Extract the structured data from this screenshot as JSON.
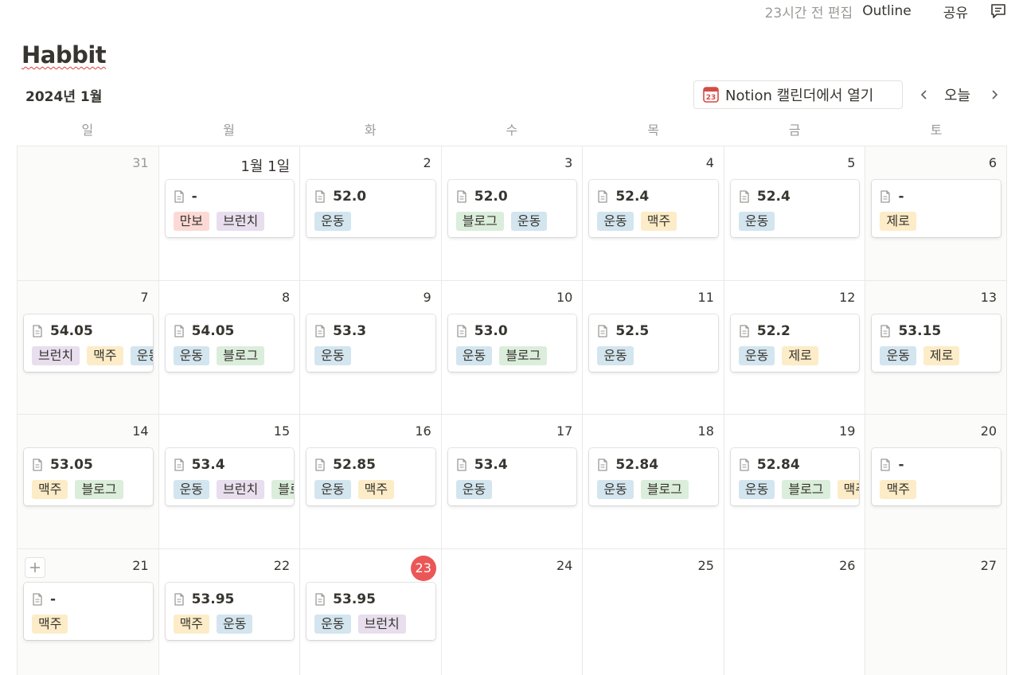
{
  "header": {
    "edited": "23시간 전 편집",
    "outline": "Outline",
    "share": "공유"
  },
  "page": {
    "title": "Habbit"
  },
  "calendar": {
    "month_label": "2024년 1월",
    "open_button_label": "Notion 캘린더에서 열기",
    "open_button_icon_number": "23",
    "today_label": "오늘",
    "weekdays": [
      "일",
      "월",
      "화",
      "수",
      "목",
      "금",
      "토"
    ],
    "tag_colors": {
      "만보": "#fdd9d6",
      "브런치": "#e8deee",
      "운동": "#d3e5ef",
      "블로그": "#dbeddb",
      "맥주": "#fdecc8",
      "제로": "#fdecc8"
    },
    "weeks": [
      [
        {
          "day": "31",
          "muted": true
        },
        {
          "day": "1월 1일",
          "first": true,
          "title": "-",
          "tags": [
            "만보",
            "브런치"
          ]
        },
        {
          "day": "2",
          "title": "52.0",
          "tags": [
            "운동"
          ]
        },
        {
          "day": "3",
          "title": "52.0",
          "tags": [
            "블로그",
            "운동"
          ]
        },
        {
          "day": "4",
          "title": "52.4",
          "tags": [
            "운동",
            "맥주"
          ]
        },
        {
          "day": "5",
          "title": "52.4",
          "tags": [
            "운동"
          ]
        },
        {
          "day": "6",
          "title": "-",
          "tags": [
            "제로"
          ]
        }
      ],
      [
        {
          "day": "7",
          "title": "54.05",
          "tags": [
            "브런치",
            "맥주",
            "운동"
          ]
        },
        {
          "day": "8",
          "title": "54.05",
          "tags": [
            "운동",
            "블로그"
          ]
        },
        {
          "day": "9",
          "title": "53.3",
          "tags": [
            "운동"
          ]
        },
        {
          "day": "10",
          "title": "53.0",
          "tags": [
            "운동",
            "블로그"
          ]
        },
        {
          "day": "11",
          "title": "52.5",
          "tags": [
            "운동"
          ]
        },
        {
          "day": "12",
          "title": "52.2",
          "tags": [
            "운동",
            "제로"
          ]
        },
        {
          "day": "13",
          "title": "53.15",
          "tags": [
            "운동",
            "제로"
          ]
        }
      ],
      [
        {
          "day": "14",
          "title": "53.05",
          "tags": [
            "맥주",
            "블로그"
          ]
        },
        {
          "day": "15",
          "title": "53.4",
          "tags": [
            "운동",
            "브런치",
            "블로그"
          ]
        },
        {
          "day": "16",
          "title": "52.85",
          "tags": [
            "운동",
            "맥주"
          ]
        },
        {
          "day": "17",
          "title": "53.4",
          "tags": [
            "운동"
          ]
        },
        {
          "day": "18",
          "title": "52.84",
          "tags": [
            "운동",
            "블로그"
          ]
        },
        {
          "day": "19",
          "title": "52.84",
          "tags": [
            "운동",
            "블로그",
            "맥주"
          ]
        },
        {
          "day": "20",
          "title": "-",
          "tags": [
            "맥주"
          ]
        }
      ],
      [
        {
          "day": "21",
          "add": true,
          "title": "-",
          "tags": [
            "맥주"
          ]
        },
        {
          "day": "22",
          "title": "53.95",
          "tags": [
            "맥주",
            "운동"
          ]
        },
        {
          "day": "23",
          "today": true,
          "title": "53.95",
          "tags": [
            "운동",
            "브런치"
          ]
        },
        {
          "day": "24"
        },
        {
          "day": "25"
        },
        {
          "day": "26"
        },
        {
          "day": "27"
        }
      ]
    ]
  }
}
